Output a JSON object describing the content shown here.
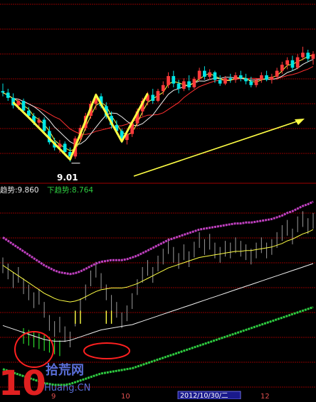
{
  "colors": {
    "background": "#000000",
    "grid": "#8b0000",
    "up_candle": "#ff3b3b",
    "down_candle": "#00e5e5",
    "ma_yellow": "#ffff44",
    "ma_white": "#f0f0f0",
    "ma_red": "#ff3030",
    "upper_band": "#c040c0",
    "lower_band": "#2ecc40",
    "arrow": "#ffff44",
    "highlight": "#ff2020",
    "logo_red": "#e02020",
    "logo_blue": "#5a6ed8"
  },
  "upper_panel": {
    "low_marker": "9.01"
  },
  "indicator_bar": {
    "upper_trend_label": "趋势:9.860",
    "lower_trend_label": "下趋势:8.764"
  },
  "x_axis": {
    "ticks": [
      "9",
      "10",
      "12"
    ],
    "selected_date": "2012/10/30/二"
  },
  "watermark": {
    "number": "10",
    "cn_text": "拾荒网",
    "url": "Huang.CN"
  },
  "chart_data": [
    {
      "type": "candlestick",
      "title": "",
      "annotation": "9.01",
      "ylim": [
        8.8,
        10.5
      ],
      "candles": [
        [
          9.95,
          10.05,
          9.88,
          9.93
        ],
        [
          9.93,
          9.98,
          9.82,
          9.86
        ],
        [
          9.86,
          9.92,
          9.72,
          9.76
        ],
        [
          9.76,
          9.85,
          9.7,
          9.82
        ],
        [
          9.82,
          9.85,
          9.66,
          9.69
        ],
        [
          9.69,
          9.74,
          9.58,
          9.62
        ],
        [
          9.62,
          9.66,
          9.5,
          9.53
        ],
        [
          9.53,
          9.6,
          9.44,
          9.57
        ],
        [
          9.57,
          9.6,
          9.4,
          9.42
        ],
        [
          9.42,
          9.48,
          9.24,
          9.27
        ],
        [
          9.27,
          9.33,
          9.16,
          9.2
        ],
        [
          9.2,
          9.3,
          9.13,
          9.25
        ],
        [
          9.25,
          9.28,
          9.11,
          9.14
        ],
        [
          9.14,
          9.2,
          9.01,
          9.08
        ],
        [
          9.08,
          9.35,
          9.05,
          9.32
        ],
        [
          9.32,
          9.5,
          9.28,
          9.46
        ],
        [
          9.46,
          9.66,
          9.42,
          9.62
        ],
        [
          9.62,
          9.82,
          9.58,
          9.78
        ],
        [
          9.78,
          9.92,
          9.7,
          9.88
        ],
        [
          9.88,
          9.92,
          9.72,
          9.75
        ],
        [
          9.75,
          9.8,
          9.58,
          9.62
        ],
        [
          9.62,
          9.68,
          9.45,
          9.5
        ],
        [
          9.5,
          9.56,
          9.38,
          9.42
        ],
        [
          9.42,
          9.45,
          9.26,
          9.3
        ],
        [
          9.3,
          9.42,
          9.24,
          9.38
        ],
        [
          9.38,
          9.56,
          9.34,
          9.52
        ],
        [
          9.52,
          9.72,
          9.48,
          9.68
        ],
        [
          9.68,
          9.86,
          9.62,
          9.82
        ],
        [
          9.82,
          9.94,
          9.76,
          9.9
        ],
        [
          9.9,
          9.98,
          9.78,
          9.82
        ],
        [
          9.82,
          9.98,
          9.8,
          9.95
        ],
        [
          9.95,
          10.08,
          9.9,
          10.03
        ],
        [
          10.03,
          10.2,
          9.99,
          10.15
        ],
        [
          10.15,
          10.22,
          10.0,
          10.05
        ],
        [
          10.05,
          10.1,
          9.92,
          9.98
        ],
        [
          9.98,
          10.12,
          9.95,
          10.08
        ],
        [
          10.08,
          10.16,
          9.96,
          10.0
        ],
        [
          10.0,
          10.14,
          9.98,
          10.11
        ],
        [
          10.11,
          10.26,
          10.08,
          10.22
        ],
        [
          10.22,
          10.28,
          10.1,
          10.14
        ],
        [
          10.14,
          10.24,
          10.1,
          10.2
        ],
        [
          10.2,
          10.22,
          10.06,
          10.1
        ],
        [
          10.1,
          10.16,
          10.02,
          10.05
        ],
        [
          10.05,
          10.15,
          10.03,
          10.12
        ],
        [
          10.12,
          10.18,
          10.06,
          10.1
        ],
        [
          10.1,
          10.2,
          10.06,
          10.16
        ],
        [
          10.16,
          10.22,
          10.08,
          10.12
        ],
        [
          10.12,
          10.18,
          10.04,
          10.08
        ],
        [
          10.08,
          10.14,
          10.0,
          10.03
        ],
        [
          10.03,
          10.12,
          10.0,
          10.1
        ],
        [
          10.1,
          10.2,
          10.06,
          10.16
        ],
        [
          10.16,
          10.22,
          10.08,
          10.1
        ],
        [
          10.1,
          10.18,
          10.05,
          10.14
        ],
        [
          10.14,
          10.26,
          10.1,
          10.22
        ],
        [
          10.22,
          10.34,
          10.18,
          10.3
        ],
        [
          10.3,
          10.4,
          10.24,
          10.36
        ],
        [
          10.36,
          10.42,
          10.22,
          10.26
        ],
        [
          10.26,
          10.44,
          10.24,
          10.4
        ],
        [
          10.4,
          10.54,
          10.36,
          10.46
        ],
        [
          10.46,
          10.5,
          10.34,
          10.38
        ],
        [
          10.38,
          10.48,
          10.3,
          10.44
        ]
      ]
    },
    {
      "type": "line",
      "title": "",
      "series": [
        {
          "name": "趋势",
          "values": [
            9.92,
            9.88,
            9.84,
            9.8,
            9.76,
            9.72,
            9.68,
            9.64,
            9.6,
            9.57,
            9.54,
            9.52,
            9.51,
            9.5,
            9.51,
            9.53,
            9.56,
            9.59,
            9.62,
            9.64,
            9.65,
            9.66,
            9.66,
            9.66,
            9.67,
            9.69,
            9.71,
            9.74,
            9.77,
            9.8,
            9.83,
            9.86,
            9.89,
            9.91,
            9.93,
            9.95,
            9.97,
            9.99,
            10.01,
            10.02,
            10.03,
            10.04,
            10.05,
            10.06,
            10.07,
            10.08,
            10.08,
            10.09,
            10.09,
            10.1,
            10.11,
            10.12,
            10.13,
            10.15,
            10.17,
            10.2,
            10.22,
            10.25,
            10.28,
            10.3,
            10.33
          ]
        },
        {
          "name": "下趋势",
          "values": [
            8.95,
            8.93,
            8.91,
            8.89,
            8.87,
            8.85,
            8.83,
            8.81,
            8.79,
            8.78,
            8.77,
            8.77,
            8.77,
            8.78,
            8.8,
            8.82,
            8.84,
            8.86,
            8.88,
            8.9,
            8.91,
            8.92,
            8.93,
            8.94,
            8.95,
            8.96,
            8.98,
            9.0,
            9.02,
            9.04,
            9.06,
            9.08,
            9.1,
            9.12,
            9.14,
            9.16,
            9.18,
            9.2,
            9.22,
            9.24,
            9.26,
            9.28,
            9.3,
            9.32,
            9.34,
            9.36,
            9.38,
            9.4,
            9.42,
            9.44,
            9.46,
            9.48,
            9.5,
            9.52,
            9.54,
            9.56,
            9.58,
            9.6,
            9.62,
            9.64,
            9.66
          ]
        }
      ]
    }
  ]
}
